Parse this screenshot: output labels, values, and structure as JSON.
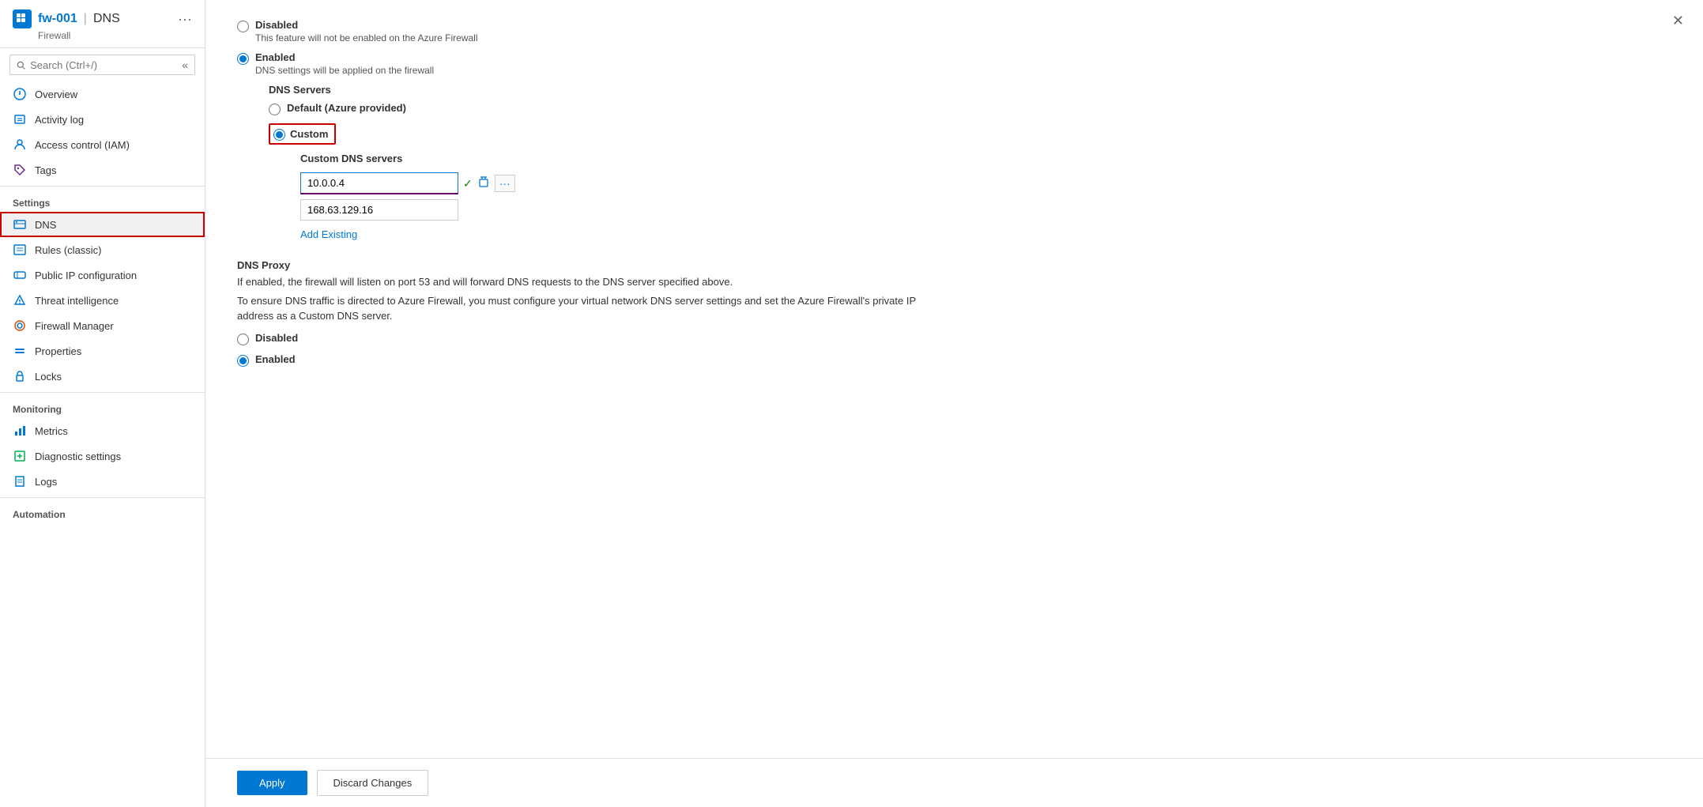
{
  "header": {
    "resource_name": "fw-001",
    "pipe": "|",
    "page_name": "DNS",
    "subtitle": "Firewall",
    "more_icon": "•••"
  },
  "search": {
    "placeholder": "Search (Ctrl+/)"
  },
  "sidebar": {
    "sections": [
      {
        "label": "",
        "items": [
          {
            "id": "overview",
            "label": "Overview",
            "icon": "overview"
          },
          {
            "id": "activity-log",
            "label": "Activity log",
            "icon": "activity"
          },
          {
            "id": "access-control",
            "label": "Access control (IAM)",
            "icon": "iam"
          },
          {
            "id": "tags",
            "label": "Tags",
            "icon": "tags"
          }
        ]
      },
      {
        "label": "Settings",
        "items": [
          {
            "id": "dns",
            "label": "DNS",
            "icon": "dns",
            "active": true
          },
          {
            "id": "rules-classic",
            "label": "Rules (classic)",
            "icon": "rules"
          },
          {
            "id": "public-ip",
            "label": "Public IP configuration",
            "icon": "public-ip"
          },
          {
            "id": "threat-intelligence",
            "label": "Threat intelligence",
            "icon": "threat"
          },
          {
            "id": "firewall-manager",
            "label": "Firewall Manager",
            "icon": "firewall-manager"
          },
          {
            "id": "properties",
            "label": "Properties",
            "icon": "properties"
          },
          {
            "id": "locks",
            "label": "Locks",
            "icon": "locks"
          }
        ]
      },
      {
        "label": "Monitoring",
        "items": [
          {
            "id": "metrics",
            "label": "Metrics",
            "icon": "metrics"
          },
          {
            "id": "diagnostic-settings",
            "label": "Diagnostic settings",
            "icon": "diagnostic"
          },
          {
            "id": "logs",
            "label": "Logs",
            "icon": "logs"
          }
        ]
      },
      {
        "label": "Automation",
        "items": []
      }
    ]
  },
  "main": {
    "dns_section_label": "DNS Servers",
    "disabled_label": "Disabled",
    "disabled_desc": "This feature will not be enabled on the Azure Firewall",
    "enabled_label": "Enabled",
    "enabled_desc": "DNS settings will be applied on the firewall",
    "dns_servers_label": "DNS Servers",
    "default_label": "Default (Azure provided)",
    "custom_label": "Custom",
    "custom_dns_servers_label": "Custom DNS servers",
    "dns_entry_1": "10.0.0.4",
    "dns_entry_2": "168.63.129.16",
    "add_existing_label": "Add Existing",
    "dns_proxy_title": "DNS Proxy",
    "dns_proxy_desc1": "If enabled, the firewall will listen on port 53 and will forward DNS requests to the DNS server specified above.",
    "dns_proxy_desc2": "To ensure DNS traffic is directed to Azure Firewall, you must configure your virtual network DNS server settings and set the Azure Firewall's private IP address as a Custom DNS server.",
    "proxy_disabled_label": "Disabled",
    "proxy_enabled_label": "Enabled",
    "apply_label": "Apply",
    "discard_label": "Discard Changes"
  }
}
